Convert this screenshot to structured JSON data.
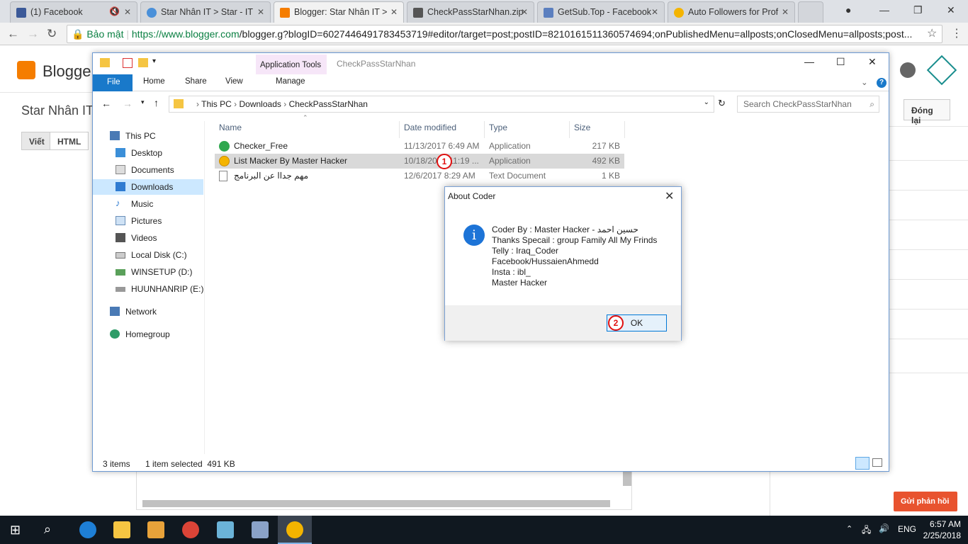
{
  "browser": {
    "tabs": [
      {
        "title": "(1) Facebook",
        "color": "#3b5998"
      },
      {
        "title": "Star Nhân IT > Star - IT",
        "color": "#4a90d9"
      },
      {
        "title": "Blogger: Star Nhân IT >",
        "color": "#f57d00"
      },
      {
        "title": "CheckPassStarNhan.zip",
        "color": "#555555"
      },
      {
        "title": "GetSub.Top - Facebook",
        "color": "#5b7fbf"
      },
      {
        "title": "Auto Followers for Prof",
        "color": "#f4b400"
      }
    ],
    "secure_label": "Bảo mật",
    "url_host": "https://www.blogger.com",
    "url_rest": "/blogger.g?blogID=6027446491783453719#editor/target=post;postID=8210161511360574694;onPublishedMenu=allposts;onClosedMenu=allposts;post..."
  },
  "blogger": {
    "logo_text": "Blogger",
    "blog_name": "Star Nhân IT",
    "mode_compose": "Viết",
    "mode_html": "HTML",
    "close_label": "Đóng lại",
    "feedback_label": "Gửi phản hồi"
  },
  "explorer": {
    "title": "CheckPassStarNhan",
    "app_tools": "Application Tools",
    "ribbon_tabs": [
      "File",
      "Home",
      "Share",
      "View",
      "Manage"
    ],
    "breadcrumb": [
      "This PC",
      "Downloads",
      "CheckPassStarNhan"
    ],
    "search_placeholder": "Search CheckPassStarNhan",
    "nav": [
      "This PC",
      "Desktop",
      "Documents",
      "Downloads",
      "Music",
      "Pictures",
      "Videos",
      "Local Disk (C:)",
      "WINSETUP (D:)",
      "HUUNHANRIP (E:)",
      "Network",
      "Homegroup"
    ],
    "columns": [
      "Name",
      "Date modified",
      "Type",
      "Size"
    ],
    "files": [
      {
        "name": "Checker_Free",
        "date": "11/13/2017 6:49 AM",
        "type": "Application",
        "size": "217 KB"
      },
      {
        "name": "List Macker By Master Hacker",
        "date": "10/18/2017 11:19 ...",
        "type": "Application",
        "size": "492 KB"
      },
      {
        "name": "مهم جداا عن البرنامج",
        "date": "12/6/2017 8:29 AM",
        "type": "Text Document",
        "size": "1 KB"
      }
    ],
    "status_items": "3 items",
    "status_selected": "1 item selected  491 KB"
  },
  "dialog": {
    "title": "About Coder",
    "lines": [
      "Coder By : Master Hacker - حسين احمد",
      "Thanks Specail : group Family All My Frinds",
      "Telly : Iraq_Coder",
      "Facebook/HussaienAhmedd",
      "Insta : ibl_",
      "Master Hacker"
    ],
    "ok_label": "OK",
    "marker1": "1",
    "marker2": "2"
  },
  "taskbar": {
    "lang": "ENG",
    "time": "6:57 AM",
    "date": "2/25/2018"
  }
}
